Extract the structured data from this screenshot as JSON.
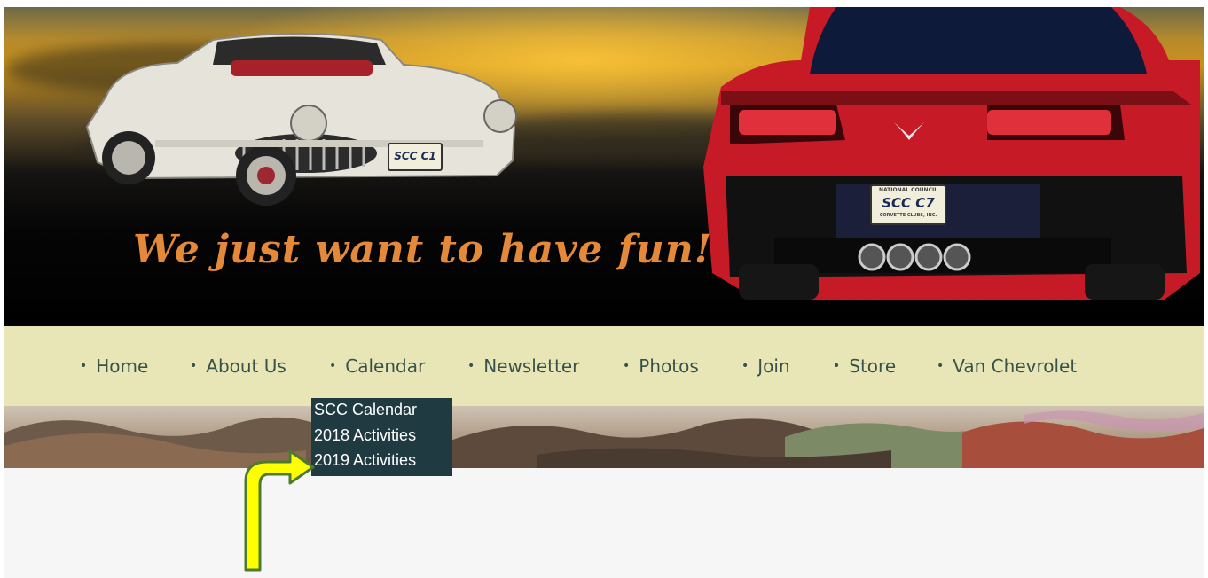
{
  "banner": {
    "tagline": "We just want to have fun!",
    "left_plate": "SCC C1",
    "right_plate": "SCC C7",
    "right_plate_top": "NATIONAL COUNCIL",
    "right_plate_bottom": "CORVETTE CLUBS, INC."
  },
  "nav": {
    "items": [
      {
        "label": "Home"
      },
      {
        "label": "About Us"
      },
      {
        "label": "Calendar"
      },
      {
        "label": "Newsletter"
      },
      {
        "label": "Photos"
      },
      {
        "label": "Join"
      },
      {
        "label": "Store"
      },
      {
        "label": "Van Chevrolet"
      }
    ],
    "bullet": "•"
  },
  "dropdown": {
    "items": [
      {
        "label": "SCC Calendar"
      },
      {
        "label": "2018 Activities"
      },
      {
        "label": "2019 Activities"
      }
    ]
  },
  "colors": {
    "nav_bg": "#e8e6b6",
    "nav_text": "#38524a",
    "dropdown_bg": "#1f3a40",
    "tagline": "#e4883a",
    "arrow": "#ffff00"
  },
  "icons": {
    "pointer": "pointer-arrow-icon"
  }
}
